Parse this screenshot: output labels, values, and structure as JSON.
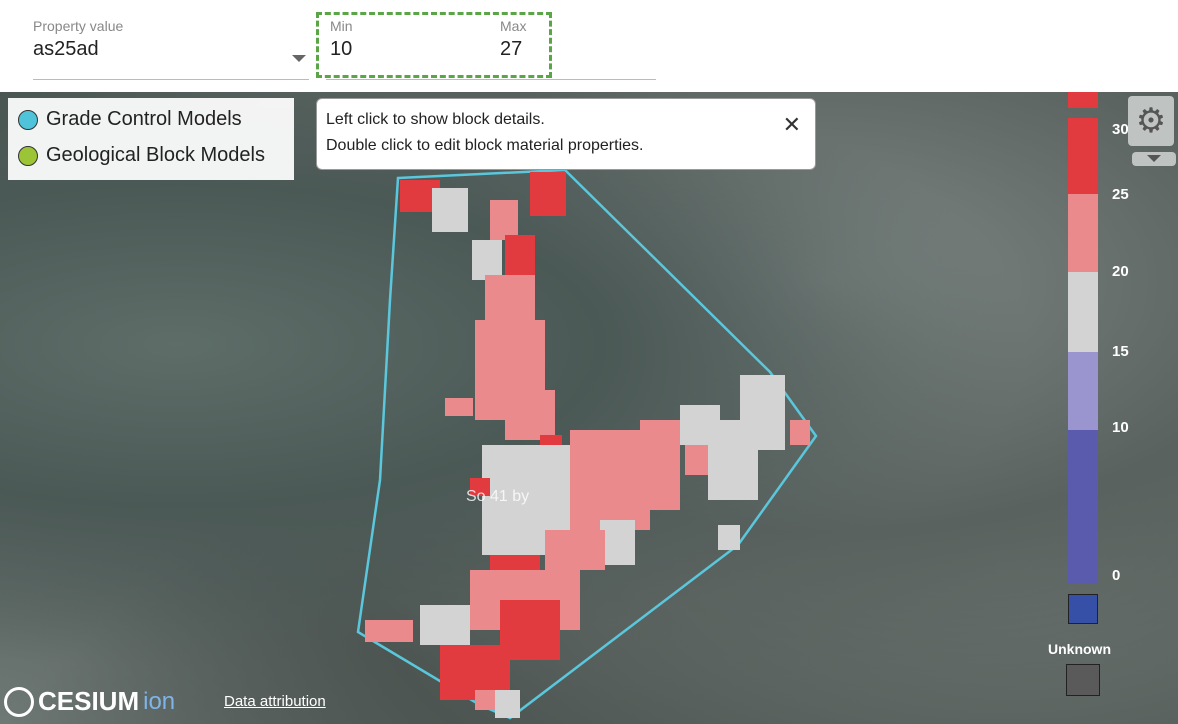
{
  "toolbar": {
    "property": {
      "label": "Property value",
      "value": "as25ad"
    },
    "min": {
      "label": "Min",
      "value": "10"
    },
    "max": {
      "label": "Max",
      "value": "27"
    }
  },
  "legend": {
    "items": [
      {
        "label": "Grade Control Models",
        "color": "#4fc3d9"
      },
      {
        "label": "Geological Block Models",
        "color": "#9bc436"
      }
    ]
  },
  "tooltip": {
    "line1": "Left click to show block details.",
    "line2": "Double click to edit block material properties.",
    "close": "✕"
  },
  "scale": {
    "ticks": [
      "30",
      "25",
      "20",
      "15",
      "10",
      "0"
    ],
    "unknown_label": "Unknown",
    "colors": {
      "red": "#e13b40",
      "pink": "#ea8a8c",
      "grey": "#d3d3d3",
      "lavender": "#9a94cf",
      "blue": "#5b5bad",
      "deepblue": "#3650a8",
      "unknown": "#5a5a5a"
    }
  },
  "map": {
    "center_label": "So  41 by",
    "polygon_color": "#5bc7dc"
  },
  "footer": {
    "brand": "CESIUM",
    "brand_suffix": "ion",
    "attribution": "Data attribution"
  }
}
